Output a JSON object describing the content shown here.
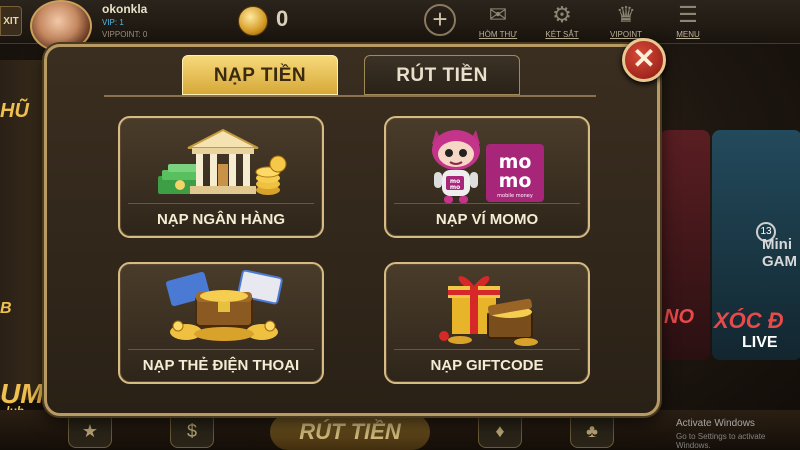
{
  "topbar": {
    "exit_label": "XIT",
    "username": "okonkla",
    "vip_label": "VIP: 1",
    "vippoint_label": "VIPPOINT: 0",
    "coins": "0",
    "menu": [
      {
        "label": "HÒM THƯ",
        "icon": "mail-icon"
      },
      {
        "label": "KÉT SẮT",
        "icon": "safe-icon"
      },
      {
        "label": "VIPOINT",
        "icon": "vip-icon"
      },
      {
        "label": "MENU",
        "icon": "menu-icon"
      }
    ]
  },
  "background": {
    "left_texts": [
      "HŨ",
      "B",
      "UM",
      "lub"
    ],
    "mini_badge": "13",
    "mini_label": "Mini GAM",
    "xoc_label": "XÓC Đ",
    "live_label": "LIVE",
    "no_label": "NO",
    "bottom_center": "RÚT TIỀN",
    "activate_title": "Activate Windows",
    "activate_sub": "Go to Settings to activate Windows."
  },
  "modal": {
    "tabs": [
      {
        "label": "NẠP TIỀN",
        "active": true
      },
      {
        "label": "RÚT TIỀN",
        "active": false
      }
    ],
    "options": [
      {
        "label": "NẠP NGÂN HÀNG",
        "icon": "bank-icon"
      },
      {
        "label": "NẠP VÍ MOMO",
        "icon": "momo-icon"
      },
      {
        "label": "NẠP THẺ ĐIỆN THOẠI",
        "icon": "phone-card-treasure-icon"
      },
      {
        "label": "NẠP GIFTCODE",
        "icon": "gift-treasure-icon"
      }
    ],
    "momo_logo_text": [
      "mo",
      "mo"
    ],
    "momo_sub": "mobile money",
    "momo_mascot_text": [
      "mo",
      "mo"
    ],
    "close_icon": "close-icon"
  },
  "colors": {
    "accent_gold": "#d6a838",
    "panel_border": "#b89a64",
    "momo_pink": "#a7267a",
    "close_red": "#b82a20"
  }
}
